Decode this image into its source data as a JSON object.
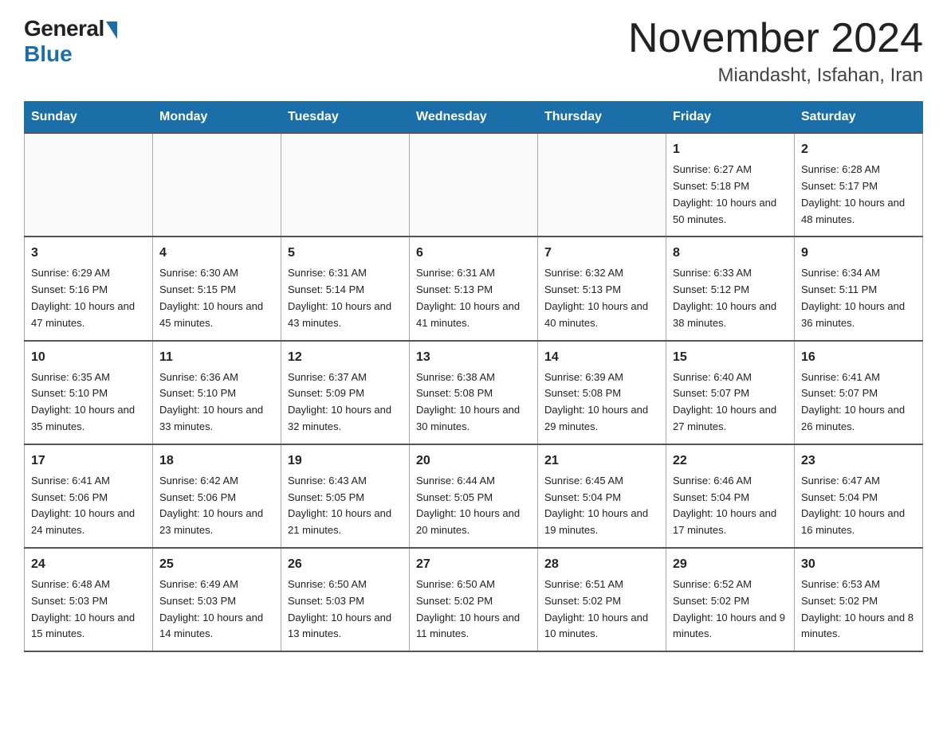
{
  "header": {
    "logo_general": "General",
    "logo_blue": "Blue",
    "month_title": "November 2024",
    "location": "Miandasht, Isfahan, Iran"
  },
  "weekdays": [
    "Sunday",
    "Monday",
    "Tuesday",
    "Wednesday",
    "Thursday",
    "Friday",
    "Saturday"
  ],
  "weeks": [
    [
      {
        "day": "",
        "sunrise": "",
        "sunset": "",
        "daylight": ""
      },
      {
        "day": "",
        "sunrise": "",
        "sunset": "",
        "daylight": ""
      },
      {
        "day": "",
        "sunrise": "",
        "sunset": "",
        "daylight": ""
      },
      {
        "day": "",
        "sunrise": "",
        "sunset": "",
        "daylight": ""
      },
      {
        "day": "",
        "sunrise": "",
        "sunset": "",
        "daylight": ""
      },
      {
        "day": "1",
        "sunrise": "Sunrise: 6:27 AM",
        "sunset": "Sunset: 5:18 PM",
        "daylight": "Daylight: 10 hours and 50 minutes."
      },
      {
        "day": "2",
        "sunrise": "Sunrise: 6:28 AM",
        "sunset": "Sunset: 5:17 PM",
        "daylight": "Daylight: 10 hours and 48 minutes."
      }
    ],
    [
      {
        "day": "3",
        "sunrise": "Sunrise: 6:29 AM",
        "sunset": "Sunset: 5:16 PM",
        "daylight": "Daylight: 10 hours and 47 minutes."
      },
      {
        "day": "4",
        "sunrise": "Sunrise: 6:30 AM",
        "sunset": "Sunset: 5:15 PM",
        "daylight": "Daylight: 10 hours and 45 minutes."
      },
      {
        "day": "5",
        "sunrise": "Sunrise: 6:31 AM",
        "sunset": "Sunset: 5:14 PM",
        "daylight": "Daylight: 10 hours and 43 minutes."
      },
      {
        "day": "6",
        "sunrise": "Sunrise: 6:31 AM",
        "sunset": "Sunset: 5:13 PM",
        "daylight": "Daylight: 10 hours and 41 minutes."
      },
      {
        "day": "7",
        "sunrise": "Sunrise: 6:32 AM",
        "sunset": "Sunset: 5:13 PM",
        "daylight": "Daylight: 10 hours and 40 minutes."
      },
      {
        "day": "8",
        "sunrise": "Sunrise: 6:33 AM",
        "sunset": "Sunset: 5:12 PM",
        "daylight": "Daylight: 10 hours and 38 minutes."
      },
      {
        "day": "9",
        "sunrise": "Sunrise: 6:34 AM",
        "sunset": "Sunset: 5:11 PM",
        "daylight": "Daylight: 10 hours and 36 minutes."
      }
    ],
    [
      {
        "day": "10",
        "sunrise": "Sunrise: 6:35 AM",
        "sunset": "Sunset: 5:10 PM",
        "daylight": "Daylight: 10 hours and 35 minutes."
      },
      {
        "day": "11",
        "sunrise": "Sunrise: 6:36 AM",
        "sunset": "Sunset: 5:10 PM",
        "daylight": "Daylight: 10 hours and 33 minutes."
      },
      {
        "day": "12",
        "sunrise": "Sunrise: 6:37 AM",
        "sunset": "Sunset: 5:09 PM",
        "daylight": "Daylight: 10 hours and 32 minutes."
      },
      {
        "day": "13",
        "sunrise": "Sunrise: 6:38 AM",
        "sunset": "Sunset: 5:08 PM",
        "daylight": "Daylight: 10 hours and 30 minutes."
      },
      {
        "day": "14",
        "sunrise": "Sunrise: 6:39 AM",
        "sunset": "Sunset: 5:08 PM",
        "daylight": "Daylight: 10 hours and 29 minutes."
      },
      {
        "day": "15",
        "sunrise": "Sunrise: 6:40 AM",
        "sunset": "Sunset: 5:07 PM",
        "daylight": "Daylight: 10 hours and 27 minutes."
      },
      {
        "day": "16",
        "sunrise": "Sunrise: 6:41 AM",
        "sunset": "Sunset: 5:07 PM",
        "daylight": "Daylight: 10 hours and 26 minutes."
      }
    ],
    [
      {
        "day": "17",
        "sunrise": "Sunrise: 6:41 AM",
        "sunset": "Sunset: 5:06 PM",
        "daylight": "Daylight: 10 hours and 24 minutes."
      },
      {
        "day": "18",
        "sunrise": "Sunrise: 6:42 AM",
        "sunset": "Sunset: 5:06 PM",
        "daylight": "Daylight: 10 hours and 23 minutes."
      },
      {
        "day": "19",
        "sunrise": "Sunrise: 6:43 AM",
        "sunset": "Sunset: 5:05 PM",
        "daylight": "Daylight: 10 hours and 21 minutes."
      },
      {
        "day": "20",
        "sunrise": "Sunrise: 6:44 AM",
        "sunset": "Sunset: 5:05 PM",
        "daylight": "Daylight: 10 hours and 20 minutes."
      },
      {
        "day": "21",
        "sunrise": "Sunrise: 6:45 AM",
        "sunset": "Sunset: 5:04 PM",
        "daylight": "Daylight: 10 hours and 19 minutes."
      },
      {
        "day": "22",
        "sunrise": "Sunrise: 6:46 AM",
        "sunset": "Sunset: 5:04 PM",
        "daylight": "Daylight: 10 hours and 17 minutes."
      },
      {
        "day": "23",
        "sunrise": "Sunrise: 6:47 AM",
        "sunset": "Sunset: 5:04 PM",
        "daylight": "Daylight: 10 hours and 16 minutes."
      }
    ],
    [
      {
        "day": "24",
        "sunrise": "Sunrise: 6:48 AM",
        "sunset": "Sunset: 5:03 PM",
        "daylight": "Daylight: 10 hours and 15 minutes."
      },
      {
        "day": "25",
        "sunrise": "Sunrise: 6:49 AM",
        "sunset": "Sunset: 5:03 PM",
        "daylight": "Daylight: 10 hours and 14 minutes."
      },
      {
        "day": "26",
        "sunrise": "Sunrise: 6:50 AM",
        "sunset": "Sunset: 5:03 PM",
        "daylight": "Daylight: 10 hours and 13 minutes."
      },
      {
        "day": "27",
        "sunrise": "Sunrise: 6:50 AM",
        "sunset": "Sunset: 5:02 PM",
        "daylight": "Daylight: 10 hours and 11 minutes."
      },
      {
        "day": "28",
        "sunrise": "Sunrise: 6:51 AM",
        "sunset": "Sunset: 5:02 PM",
        "daylight": "Daylight: 10 hours and 10 minutes."
      },
      {
        "day": "29",
        "sunrise": "Sunrise: 6:52 AM",
        "sunset": "Sunset: 5:02 PM",
        "daylight": "Daylight: 10 hours and 9 minutes."
      },
      {
        "day": "30",
        "sunrise": "Sunrise: 6:53 AM",
        "sunset": "Sunset: 5:02 PM",
        "daylight": "Daylight: 10 hours and 8 minutes."
      }
    ]
  ]
}
